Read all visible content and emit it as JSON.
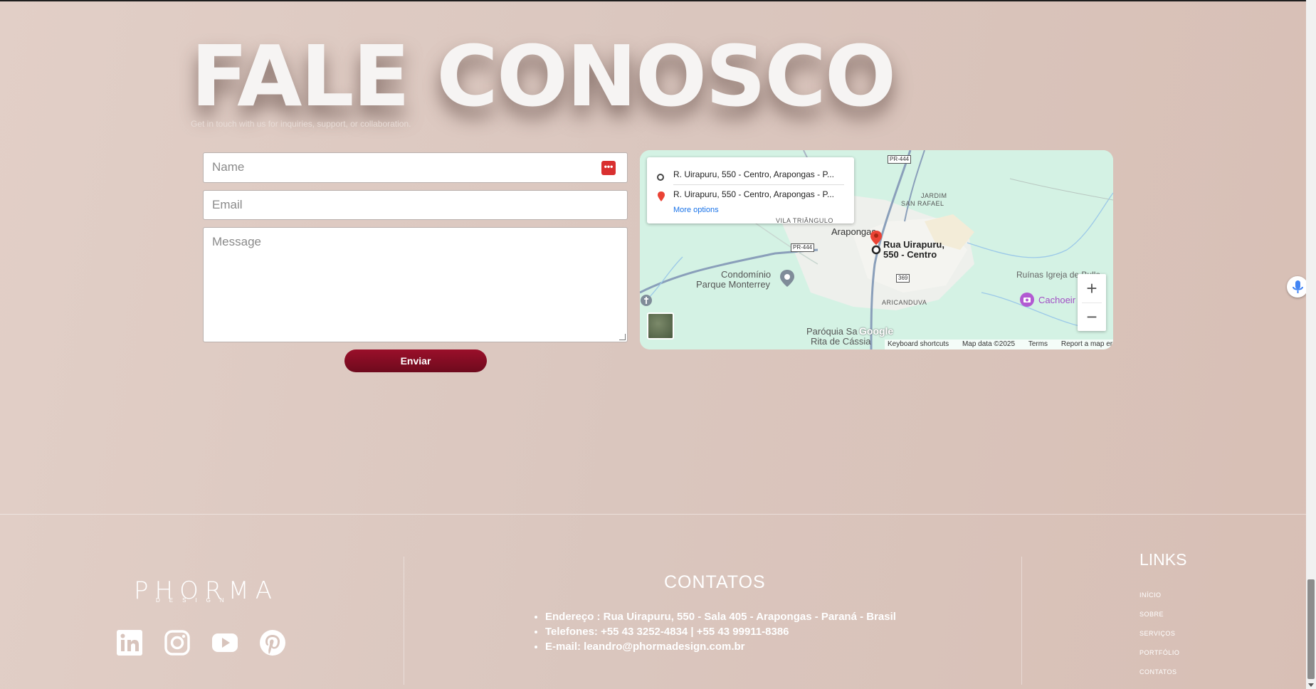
{
  "hero": {
    "title": "FALE CONOSCO",
    "subtitle": "Get in touch with us for inquiries, support, or collaboration."
  },
  "form": {
    "name_placeholder": "Name",
    "email_placeholder": "Email",
    "message_placeholder": "Message",
    "submit_label": "Enviar"
  },
  "map": {
    "directions": {
      "origin": "R. Uirapuru, 550 - Centro, Arapongas - P...",
      "destination": "R. Uirapuru, 550 - Centro, Arapongas - P...",
      "more_options": "More options"
    },
    "labels": {
      "vila_triangulo": "VILA TRIÂNGULO",
      "jardim_line1": "JARDIM",
      "jardim_line2": "SAN RAFAEL",
      "arapongas": "Arapongas",
      "pin_line1": "Rua Uirapuru,",
      "pin_line2": "550 - Centro",
      "condominio_line1": "Condomínio",
      "condominio_line2": "Parque Monterrey",
      "aricanduva": "ARICANDUVA",
      "ruinas": "Ruínas Igreja de Bulle",
      "cachoeira": "Cachoeir",
      "paroquia_line1": "Paróquia Sa",
      "paroquia_line2": "Rita de Cássia",
      "pr444_top": "PR-444",
      "pr444_left": "PR-444",
      "r369": "369"
    },
    "zoom_in": "+",
    "zoom_out": "−",
    "google": "Google",
    "footer": {
      "keyboard": "Keyboard shortcuts",
      "data": "Map data ©2025",
      "terms": "Terms",
      "report": "Report a map error"
    }
  },
  "footer": {
    "logo_main": "PHORMA",
    "logo_sub": "DESIGN",
    "contacts_title": "CONTATOS",
    "contacts": [
      "Endereço : Rua Uirapuru, 550 - Sala 405 - Arapongas - Paraná - Brasil",
      "Telefones: +55 43 3252-4834 | +55 43 99911-8386",
      "E-mail: leandro@phormadesign.com.br"
    ],
    "links_title": "LINKS",
    "links": [
      "INÍCIO",
      "SOBRE",
      "SERVIÇOS",
      "PORTFÓLIO",
      "CONTATOS"
    ],
    "social": [
      "linkedin-icon",
      "instagram-icon",
      "youtube-icon",
      "pinterest-icon"
    ]
  },
  "colors": {
    "brand_button": "#8a0d25",
    "background": "#dccac2"
  }
}
